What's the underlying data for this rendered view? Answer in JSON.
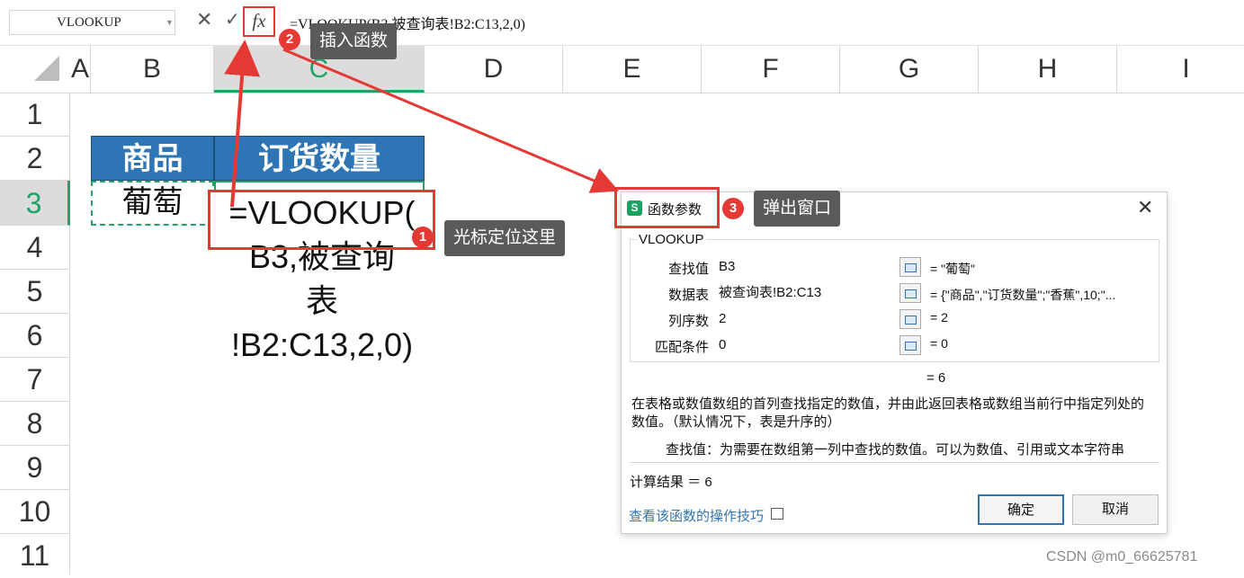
{
  "formula_bar": {
    "name_box": "VLOOKUP",
    "cancel_icon": "✕",
    "enter_icon": "✓",
    "fx_label": "fx",
    "formula": "=VLOOKUP(B3,被查询表!B2:C13,2,0)"
  },
  "columns": [
    "A",
    "B",
    "C",
    "D",
    "E",
    "F",
    "G",
    "H",
    "I"
  ],
  "rows": [
    "1",
    "2",
    "3",
    "4",
    "5",
    "6",
    "7",
    "8",
    "9",
    "10",
    "11"
  ],
  "sheet": {
    "header_b": "商品",
    "header_c": "订货数量",
    "cell_b3": "葡萄",
    "edit_lines": [
      "=VLOOKUP(",
      "B3,被查询",
      "表",
      "!B2:C13,2,0)"
    ]
  },
  "callouts": [
    {
      "num": "1",
      "text": "光标定位这里"
    },
    {
      "num": "2",
      "text": "插入函数"
    },
    {
      "num": "3",
      "text": "弹出窗口"
    }
  ],
  "dialog": {
    "icon": "S",
    "title": "函数参数",
    "close": "✕",
    "function_name": "VLOOKUP",
    "params": [
      {
        "label": "查找值",
        "value": "B3",
        "result": "= \"葡萄\""
      },
      {
        "label": "数据表",
        "value": "被查询表!B2:C13",
        "result": "= {\"商品\",\"订货数量\";\"香蕉\",10;\"..."
      },
      {
        "label": "列序数",
        "value": "2",
        "result": "= 2"
      },
      {
        "label": "匹配条件",
        "value": "0",
        "result": "= 0"
      }
    ],
    "formula_result": "= 6",
    "description": "在表格或数值数组的首列查找指定的数值，并由此返回表格或数组当前行中指定列处的数值。（默认情况下，表是升序的）",
    "param_description": "查找值：为需要在数组第一列中查找的数值。可以为数值、引用或文本字符串",
    "calc_result": "计算结果 ＝ 6",
    "help_link": "查看该函数的操作技巧",
    "ok": "确定",
    "cancel": "取消"
  },
  "watermark": "CSDN @m0_66625781",
  "colors": {
    "accent_red": "#e53935",
    "header_blue": "#2e75b6",
    "selection_green": "#21a366",
    "tooltip_gray": "#5a5a5a"
  }
}
